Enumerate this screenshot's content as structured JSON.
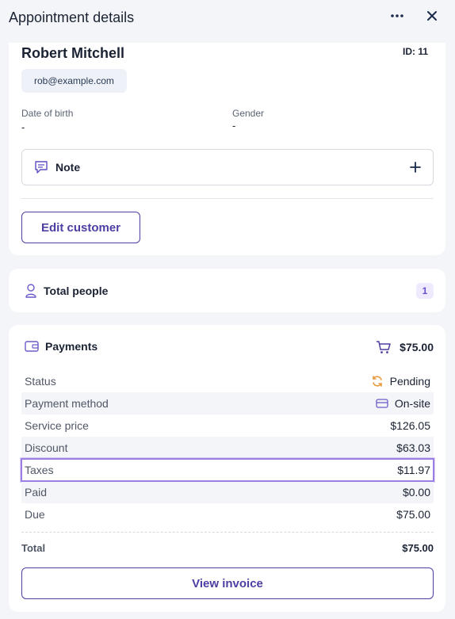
{
  "header": {
    "title": "Appointment details",
    "more_icon": "more-horizontal-icon",
    "close_icon": "close-icon"
  },
  "customer": {
    "name": "Robert Mitchell",
    "id_label": "ID: 11",
    "email": "rob@example.com",
    "dob_label": "Date of birth",
    "dob_value": "-",
    "gender_label": "Gender",
    "gender_value": "-",
    "note_label": "Note",
    "edit_button": "Edit customer"
  },
  "people": {
    "label": "Total people",
    "count": "1"
  },
  "payments": {
    "label": "Payments",
    "amount": "$75.00",
    "rows": [
      {
        "label": "Status",
        "value": "Pending",
        "icon": "refresh-icon"
      },
      {
        "label": "Payment method",
        "value": "On-site",
        "icon": "card-icon"
      },
      {
        "label": "Service price",
        "value": "$126.05"
      },
      {
        "label": "Discount",
        "value": "$63.03"
      },
      {
        "label": "Taxes",
        "value": "$11.97"
      },
      {
        "label": "Paid",
        "value": "$0.00"
      },
      {
        "label": "Due",
        "value": "$75.00"
      }
    ],
    "total_label": "Total",
    "total_value": "$75.00",
    "invoice_button": "View invoice"
  },
  "colors": {
    "accent": "#4b3fa3",
    "pending": "#e89b3c",
    "highlight": "#9b7fe6"
  }
}
